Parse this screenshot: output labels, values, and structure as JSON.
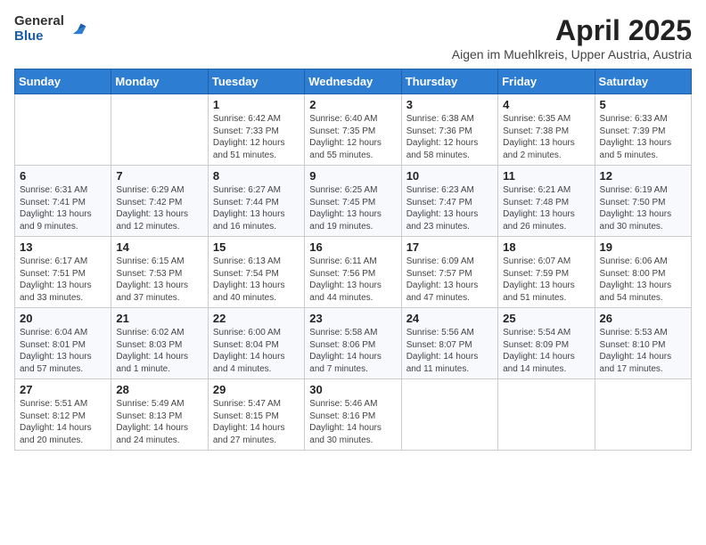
{
  "header": {
    "logo": {
      "general": "General",
      "blue": "Blue"
    },
    "title": "April 2025",
    "subtitle": "Aigen im Muehlkreis, Upper Austria, Austria"
  },
  "weekdays": [
    "Sunday",
    "Monday",
    "Tuesday",
    "Wednesday",
    "Thursday",
    "Friday",
    "Saturday"
  ],
  "weeks": [
    [
      {
        "day": "",
        "info": ""
      },
      {
        "day": "",
        "info": ""
      },
      {
        "day": "1",
        "info": "Sunrise: 6:42 AM\nSunset: 7:33 PM\nDaylight: 12 hours and 51 minutes."
      },
      {
        "day": "2",
        "info": "Sunrise: 6:40 AM\nSunset: 7:35 PM\nDaylight: 12 hours and 55 minutes."
      },
      {
        "day": "3",
        "info": "Sunrise: 6:38 AM\nSunset: 7:36 PM\nDaylight: 12 hours and 58 minutes."
      },
      {
        "day": "4",
        "info": "Sunrise: 6:35 AM\nSunset: 7:38 PM\nDaylight: 13 hours and 2 minutes."
      },
      {
        "day": "5",
        "info": "Sunrise: 6:33 AM\nSunset: 7:39 PM\nDaylight: 13 hours and 5 minutes."
      }
    ],
    [
      {
        "day": "6",
        "info": "Sunrise: 6:31 AM\nSunset: 7:41 PM\nDaylight: 13 hours and 9 minutes."
      },
      {
        "day": "7",
        "info": "Sunrise: 6:29 AM\nSunset: 7:42 PM\nDaylight: 13 hours and 12 minutes."
      },
      {
        "day": "8",
        "info": "Sunrise: 6:27 AM\nSunset: 7:44 PM\nDaylight: 13 hours and 16 minutes."
      },
      {
        "day": "9",
        "info": "Sunrise: 6:25 AM\nSunset: 7:45 PM\nDaylight: 13 hours and 19 minutes."
      },
      {
        "day": "10",
        "info": "Sunrise: 6:23 AM\nSunset: 7:47 PM\nDaylight: 13 hours and 23 minutes."
      },
      {
        "day": "11",
        "info": "Sunrise: 6:21 AM\nSunset: 7:48 PM\nDaylight: 13 hours and 26 minutes."
      },
      {
        "day": "12",
        "info": "Sunrise: 6:19 AM\nSunset: 7:50 PM\nDaylight: 13 hours and 30 minutes."
      }
    ],
    [
      {
        "day": "13",
        "info": "Sunrise: 6:17 AM\nSunset: 7:51 PM\nDaylight: 13 hours and 33 minutes."
      },
      {
        "day": "14",
        "info": "Sunrise: 6:15 AM\nSunset: 7:53 PM\nDaylight: 13 hours and 37 minutes."
      },
      {
        "day": "15",
        "info": "Sunrise: 6:13 AM\nSunset: 7:54 PM\nDaylight: 13 hours and 40 minutes."
      },
      {
        "day": "16",
        "info": "Sunrise: 6:11 AM\nSunset: 7:56 PM\nDaylight: 13 hours and 44 minutes."
      },
      {
        "day": "17",
        "info": "Sunrise: 6:09 AM\nSunset: 7:57 PM\nDaylight: 13 hours and 47 minutes."
      },
      {
        "day": "18",
        "info": "Sunrise: 6:07 AM\nSunset: 7:59 PM\nDaylight: 13 hours and 51 minutes."
      },
      {
        "day": "19",
        "info": "Sunrise: 6:06 AM\nSunset: 8:00 PM\nDaylight: 13 hours and 54 minutes."
      }
    ],
    [
      {
        "day": "20",
        "info": "Sunrise: 6:04 AM\nSunset: 8:01 PM\nDaylight: 13 hours and 57 minutes."
      },
      {
        "day": "21",
        "info": "Sunrise: 6:02 AM\nSunset: 8:03 PM\nDaylight: 14 hours and 1 minute."
      },
      {
        "day": "22",
        "info": "Sunrise: 6:00 AM\nSunset: 8:04 PM\nDaylight: 14 hours and 4 minutes."
      },
      {
        "day": "23",
        "info": "Sunrise: 5:58 AM\nSunset: 8:06 PM\nDaylight: 14 hours and 7 minutes."
      },
      {
        "day": "24",
        "info": "Sunrise: 5:56 AM\nSunset: 8:07 PM\nDaylight: 14 hours and 11 minutes."
      },
      {
        "day": "25",
        "info": "Sunrise: 5:54 AM\nSunset: 8:09 PM\nDaylight: 14 hours and 14 minutes."
      },
      {
        "day": "26",
        "info": "Sunrise: 5:53 AM\nSunset: 8:10 PM\nDaylight: 14 hours and 17 minutes."
      }
    ],
    [
      {
        "day": "27",
        "info": "Sunrise: 5:51 AM\nSunset: 8:12 PM\nDaylight: 14 hours and 20 minutes."
      },
      {
        "day": "28",
        "info": "Sunrise: 5:49 AM\nSunset: 8:13 PM\nDaylight: 14 hours and 24 minutes."
      },
      {
        "day": "29",
        "info": "Sunrise: 5:47 AM\nSunset: 8:15 PM\nDaylight: 14 hours and 27 minutes."
      },
      {
        "day": "30",
        "info": "Sunrise: 5:46 AM\nSunset: 8:16 PM\nDaylight: 14 hours and 30 minutes."
      },
      {
        "day": "",
        "info": ""
      },
      {
        "day": "",
        "info": ""
      },
      {
        "day": "",
        "info": ""
      }
    ]
  ]
}
